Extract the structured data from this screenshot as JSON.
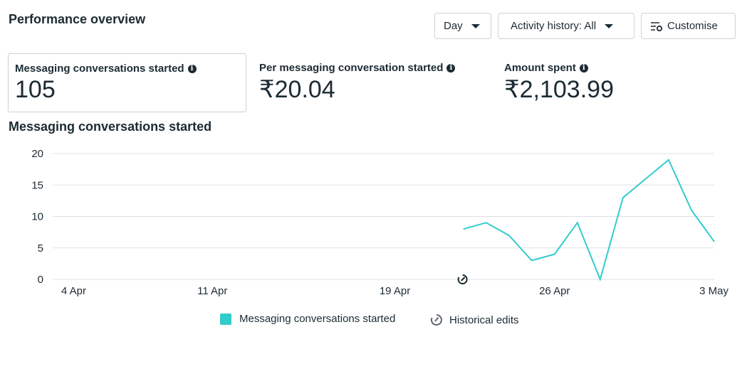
{
  "header": {
    "title": "Performance overview",
    "day_label": "Day",
    "activity_label": "Activity history: All",
    "customise_label": "Customise"
  },
  "metrics": [
    {
      "label": "Messaging conversations started",
      "value": "105"
    },
    {
      "label": "Per messaging conversation started",
      "value": "₹20.04"
    },
    {
      "label": "Amount spent",
      "value": "₹2,103.99"
    }
  ],
  "chart_title": "Messaging conversations started",
  "legend": {
    "series": "Messaging conversations started",
    "edits": "Historical edits"
  },
  "colors": {
    "series": "#33cccc",
    "grid": "#dddfe2",
    "text": "#1c2b33"
  },
  "chart_data": {
    "type": "line",
    "x_ticks": [
      "4 Apr",
      "11 Apr",
      "19 Apr",
      "26 Apr",
      "3 May"
    ],
    "y_ticks": [
      0,
      5,
      10,
      15,
      20
    ],
    "ylim": [
      0,
      20
    ],
    "grid": true,
    "legend_position": "bottom",
    "historical_edit_marker": "22 Apr",
    "series": [
      {
        "name": "Messaging conversations started",
        "x": [
          "22 Apr",
          "23 Apr",
          "24 Apr",
          "25 Apr",
          "26 Apr",
          "27 Apr",
          "28 Apr",
          "29 Apr",
          "30 Apr",
          "1 May",
          "2 May",
          "3 May"
        ],
        "values": [
          8,
          9,
          7,
          3,
          4,
          9,
          0,
          13,
          16,
          19,
          11,
          6
        ]
      }
    ]
  }
}
